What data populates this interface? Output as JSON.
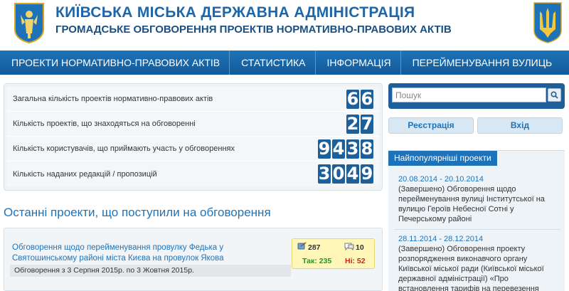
{
  "header": {
    "title": "КИЇВСЬКА МІСЬКА ДЕРЖАВНА АДМІНІСТРАЦІЯ",
    "subtitle": "ГРОМАДСЬКЕ ОБГОВОРЕННЯ ПРОЕКТІВ НОРМАТИВНО-ПРАВОВИХ АКТІВ"
  },
  "nav": {
    "items": [
      {
        "label": "ПРОЕКТИ НОРМАТИВНО-ПРАВОВИХ АКТІВ"
      },
      {
        "label": "СТАТИСТИКА"
      },
      {
        "label": "ІНФОРМАЦІЯ"
      },
      {
        "label": "ПЕРЕЙМЕНУВАННЯ ВУЛИЦЬ"
      }
    ]
  },
  "stats": [
    {
      "label": "Загальна кількість проектів нормативно-правових актів",
      "digits": [
        "6",
        "6"
      ]
    },
    {
      "label": "Кількість проектів, що знаходяться на обговоренні",
      "digits": [
        "2",
        "7"
      ]
    },
    {
      "label": "Кількість користувачів, що приймають участь у обговореннях",
      "digits": [
        "9",
        "4",
        "3",
        "8"
      ]
    },
    {
      "label": "Кількість наданих редакцій / пропозицій",
      "digits": [
        "3",
        "0",
        "4",
        "9"
      ]
    }
  ],
  "section": {
    "title": "Останні проекти, що поступили на обговорення"
  },
  "project": {
    "title": "Обговорення щодо перейменування провулку Федька у Святошинському районі міста Києва на провулок Якова Шульгіна",
    "dates": "Обговорення з 3 Серпня 2015р. по 3 Жовтня 2015р.",
    "views": "287",
    "comments": "10",
    "yes": "Так: 235",
    "no": "Ні: 52"
  },
  "sidebar": {
    "search_placeholder": "Пошук",
    "register_label": "Реєстрація",
    "login_label": "Вхід",
    "popular_title": "Найпопулярніші проекти",
    "popular": [
      {
        "dates": "20.08.2014 - 20.10.2014",
        "text": "(Завершено) Обговорення щодо перейменування вулиці Інститутської на вулицю Героїв Небесної Сотні у Печерському районі"
      },
      {
        "dates": "28.11.2014 - 28.12.2014",
        "text": "(Завершено) Обговорення проекту розпорядження виконавчого органу Київської міської ради (Київської міської державної адміністрації) «Про встановлення тарифів на перевезення"
      }
    ]
  },
  "colors": {
    "accent": "#1e73b8",
    "nav_bg": "#1a67a8",
    "digit_bg": "#1c5f9b",
    "yes": "#1a9a23",
    "no": "#d1201c"
  }
}
